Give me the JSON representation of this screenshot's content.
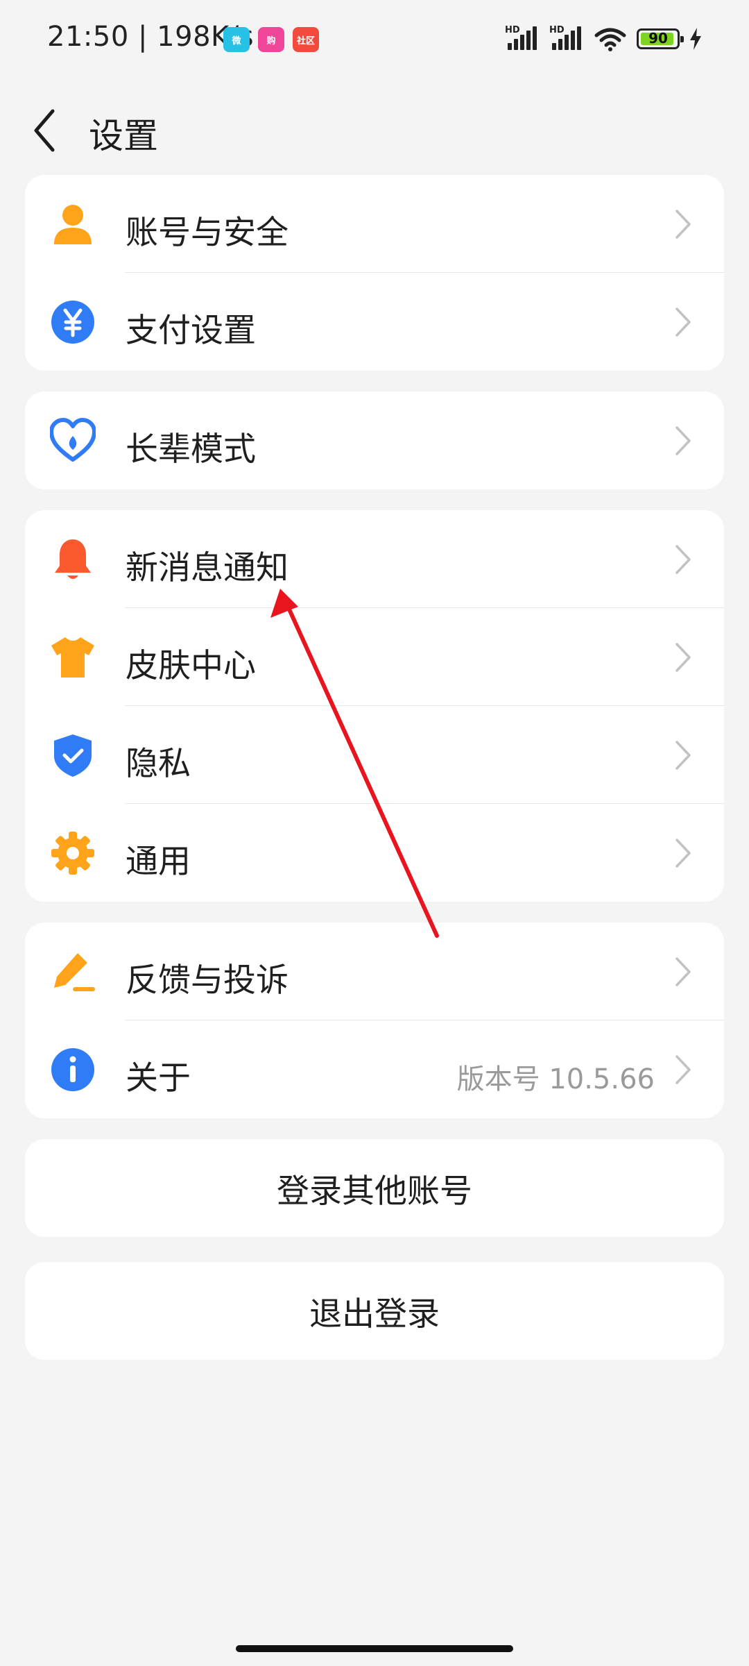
{
  "status_bar": {
    "time_speed": "21:50 | 198K/s",
    "app1": "微",
    "app2": "购",
    "app3": "社区",
    "battery": "90"
  },
  "header": {
    "title": "设置"
  },
  "groups": [
    {
      "items": [
        {
          "label": "账号与安全",
          "icon": "person-icon"
        },
        {
          "label": "支付设置",
          "icon": "yuan-icon"
        }
      ]
    },
    {
      "items": [
        {
          "label": "长辈模式",
          "icon": "heart-icon"
        }
      ]
    },
    {
      "items": [
        {
          "label": "新消息通知",
          "icon": "bell-icon"
        },
        {
          "label": "皮肤中心",
          "icon": "tshirt-icon"
        },
        {
          "label": "隐私",
          "icon": "shield-icon"
        },
        {
          "label": "通用",
          "icon": "gear-icon"
        }
      ]
    },
    {
      "items": [
        {
          "label": "反馈与投诉",
          "icon": "pen-icon"
        },
        {
          "label": "关于",
          "icon": "info-icon",
          "value": "版本号 10.5.66"
        }
      ]
    }
  ],
  "buttons": {
    "switch_account": "登录其他账号",
    "logout": "退出登录"
  },
  "colors": {
    "background": "#f4f4f4",
    "orange": "#ffa31a",
    "blue": "#2f7cf6",
    "red_orange": "#fa5a2e",
    "annotation_arrow": "#e8141e"
  }
}
